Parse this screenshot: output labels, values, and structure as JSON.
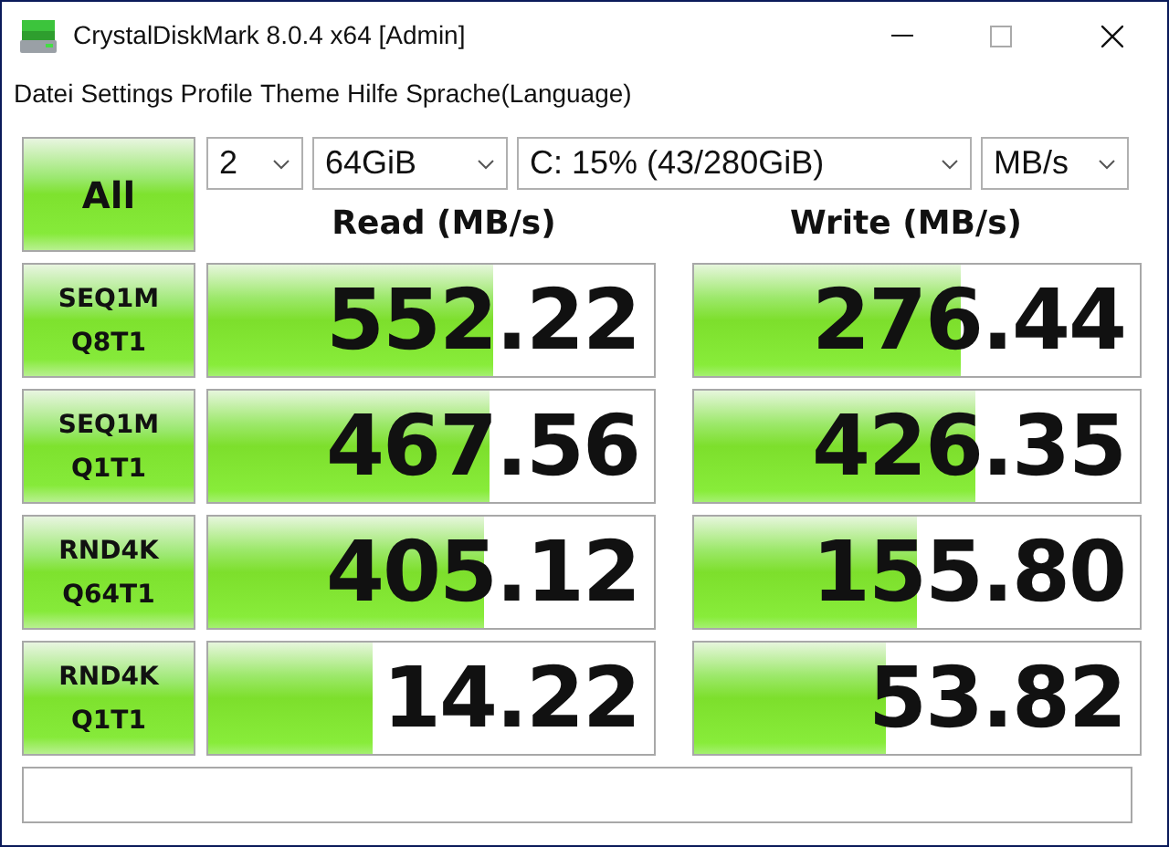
{
  "window": {
    "title": "CrystalDiskMark 8.0.4 x64 [Admin]"
  },
  "menu": [
    "Datei",
    "Settings",
    "Profile",
    "Theme",
    "Hilfe",
    "Sprache(Language)"
  ],
  "all_button": "All",
  "selectors": [
    {
      "value": "2"
    },
    {
      "value": "64GiB"
    },
    {
      "value": "C: 15% (43/280GiB)"
    },
    {
      "value": "MB/s"
    }
  ],
  "columns": [
    "Read (MB/s)",
    "Write (MB/s)"
  ],
  "tests": [
    {
      "name": "SEQ1M",
      "params": "Q8T1",
      "read": {
        "value": "552.22",
        "level": 0.64
      },
      "write": {
        "value": "276.44",
        "level": 0.6
      }
    },
    {
      "name": "SEQ1M",
      "params": "Q1T1",
      "read": {
        "value": "467.56",
        "level": 0.63
      },
      "write": {
        "value": "426.35",
        "level": 0.63
      }
    },
    {
      "name": "RND4K",
      "params": "Q64T1",
      "read": {
        "value": "405.12",
        "level": 0.62
      },
      "write": {
        "value": "155.80",
        "level": 0.5
      }
    },
    {
      "name": "RND4K",
      "params": "Q1T1",
      "read": {
        "value": "14.22",
        "level": 0.37
      },
      "write": {
        "value": "53.82",
        "level": 0.43
      }
    }
  ]
}
